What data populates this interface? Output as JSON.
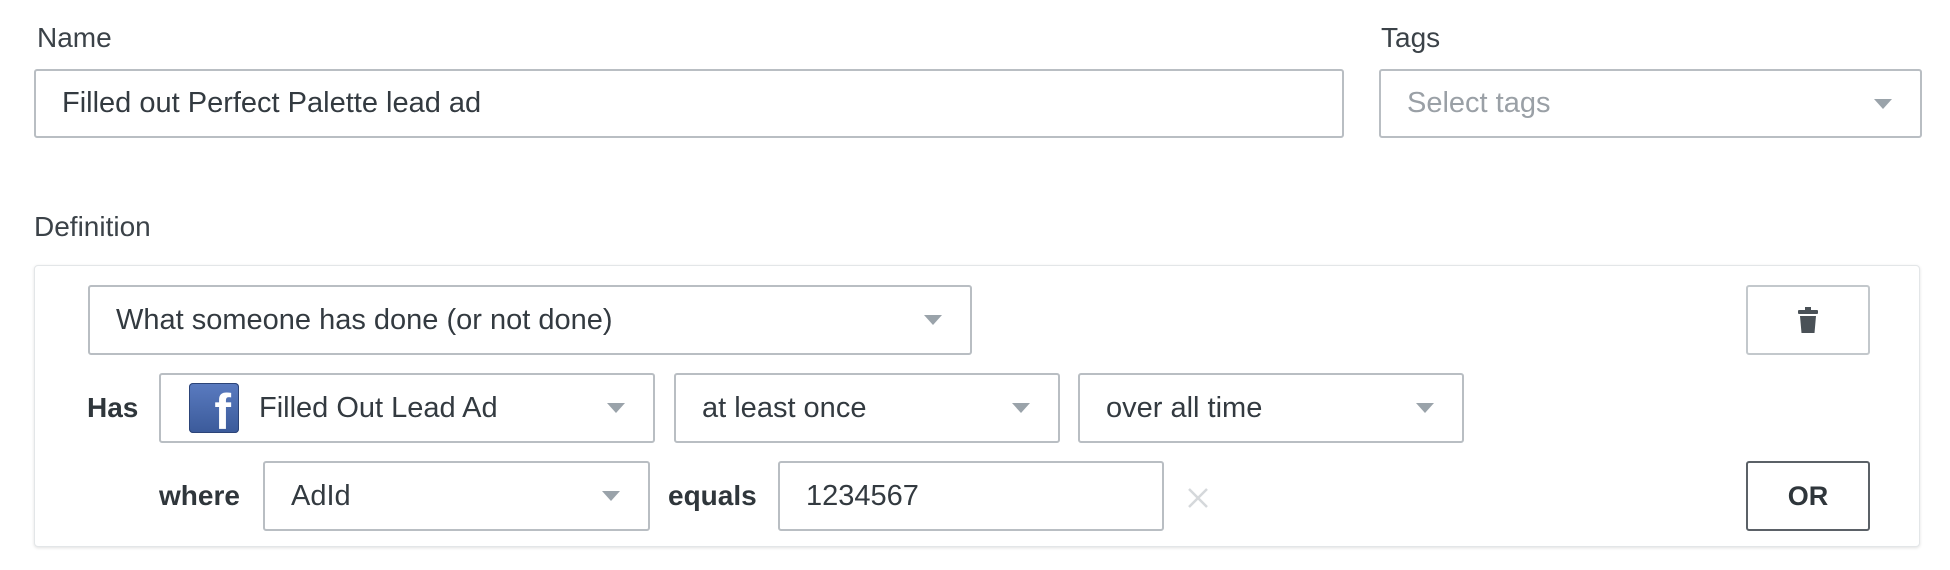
{
  "form": {
    "name_label": "Name",
    "name_value": "Filled out Perfect Palette lead ad",
    "tags_label": "Tags",
    "tags_placeholder": "Select tags",
    "definition_label": "Definition"
  },
  "condition": {
    "type_value": "What someone has done (or not done)",
    "has_label": "Has",
    "event_value": "Filled Out Lead Ad",
    "event_icon": "facebook-icon",
    "frequency_value": "at least once",
    "timeframe_value": "over all time",
    "where_label": "where",
    "property_value": "AdId",
    "operator_label": "equals",
    "filter_value": "1234567",
    "or_label": "OR",
    "delete_icon": "trash-icon",
    "clear_icon": "close-icon"
  }
}
